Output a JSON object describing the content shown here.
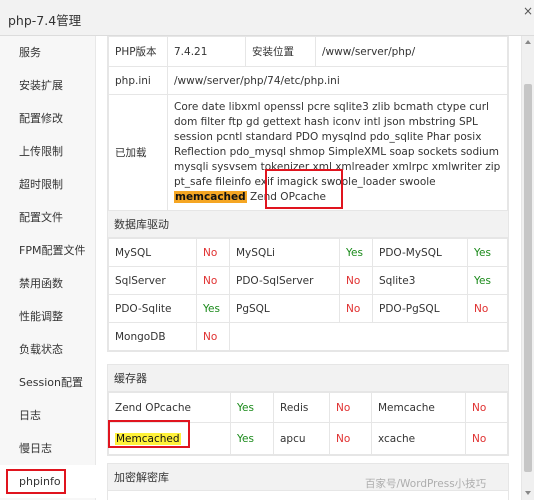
{
  "window": {
    "title": "php-7.4管理",
    "close_glyph": "×"
  },
  "sidebar": {
    "items": [
      {
        "label": "服务"
      },
      {
        "label": "安装扩展"
      },
      {
        "label": "配置修改"
      },
      {
        "label": "上传限制"
      },
      {
        "label": "超时限制"
      },
      {
        "label": "配置文件"
      },
      {
        "label": "FPM配置文件"
      },
      {
        "label": "禁用函数"
      },
      {
        "label": "性能调整"
      },
      {
        "label": "负载状态"
      },
      {
        "label": "Session配置"
      },
      {
        "label": "日志"
      },
      {
        "label": "慢日志"
      },
      {
        "label": "phpinfo"
      }
    ],
    "active": "phpinfo"
  },
  "info": {
    "version_label": "PHP版本",
    "version": "7.4.21",
    "install_label": "安装位置",
    "install_path": "/www/server/php/",
    "ini_label": "php.ini",
    "ini_path": "/www/server/php/74/etc/php.ini",
    "loaded_label": "已加载",
    "loaded_before": "Core date libxml openssl pcre sqlite3 zlib bcmath ctype curl dom filter ftp gd gettext hash iconv intl json mbstring SPL session pcntl standard PDO mysqlnd pdo_sqlite Phar posix Reflection pdo_mysql shmop SimpleXML soap sockets sodium mysqli sysvsem tokenizer xml xmlreader xmlrpc xmlwriter zip pt_safe fileinfo exif imagick swoole_loader swoole ",
    "loaded_highlight": "memcached",
    "loaded_after": " Zend OPcache"
  },
  "db": {
    "title": "数据库驱动",
    "rows": [
      [
        {
          "name": "MySQL",
          "status": "No"
        },
        {
          "name": "MySQLi",
          "status": "Yes"
        },
        {
          "name": "PDO-MySQL",
          "status": "Yes"
        }
      ],
      [
        {
          "name": "SqlServer",
          "status": "No"
        },
        {
          "name": "PDO-SqlServer",
          "status": "No"
        },
        {
          "name": "Sqlite3",
          "status": "Yes"
        }
      ],
      [
        {
          "name": "PDO-Sqlite",
          "status": "Yes"
        },
        {
          "name": "PgSQL",
          "status": "No"
        },
        {
          "name": "PDO-PgSQL",
          "status": "No"
        }
      ],
      [
        {
          "name": "MongoDB",
          "status": "No"
        }
      ]
    ]
  },
  "cache": {
    "title": "缓存器",
    "rows": [
      [
        {
          "name": "Zend OPcache",
          "status": "Yes"
        },
        {
          "name": "Redis",
          "status": "No"
        },
        {
          "name": "Memcache",
          "status": "No"
        }
      ],
      [
        {
          "name": "Memcached",
          "status": "Yes"
        },
        {
          "name": "apcu",
          "status": "No"
        },
        {
          "name": "xcache",
          "status": "No"
        }
      ]
    ]
  },
  "crypto": {
    "title": "加密解密库"
  },
  "watermark": "百家号/WordPress小技巧",
  "colors": {
    "yes": "#1a8a1a",
    "no": "#e03030",
    "annotation_red": "#e0141e",
    "highlight_orange": "#f5a623",
    "highlight_yellow": "#fff23a"
  }
}
